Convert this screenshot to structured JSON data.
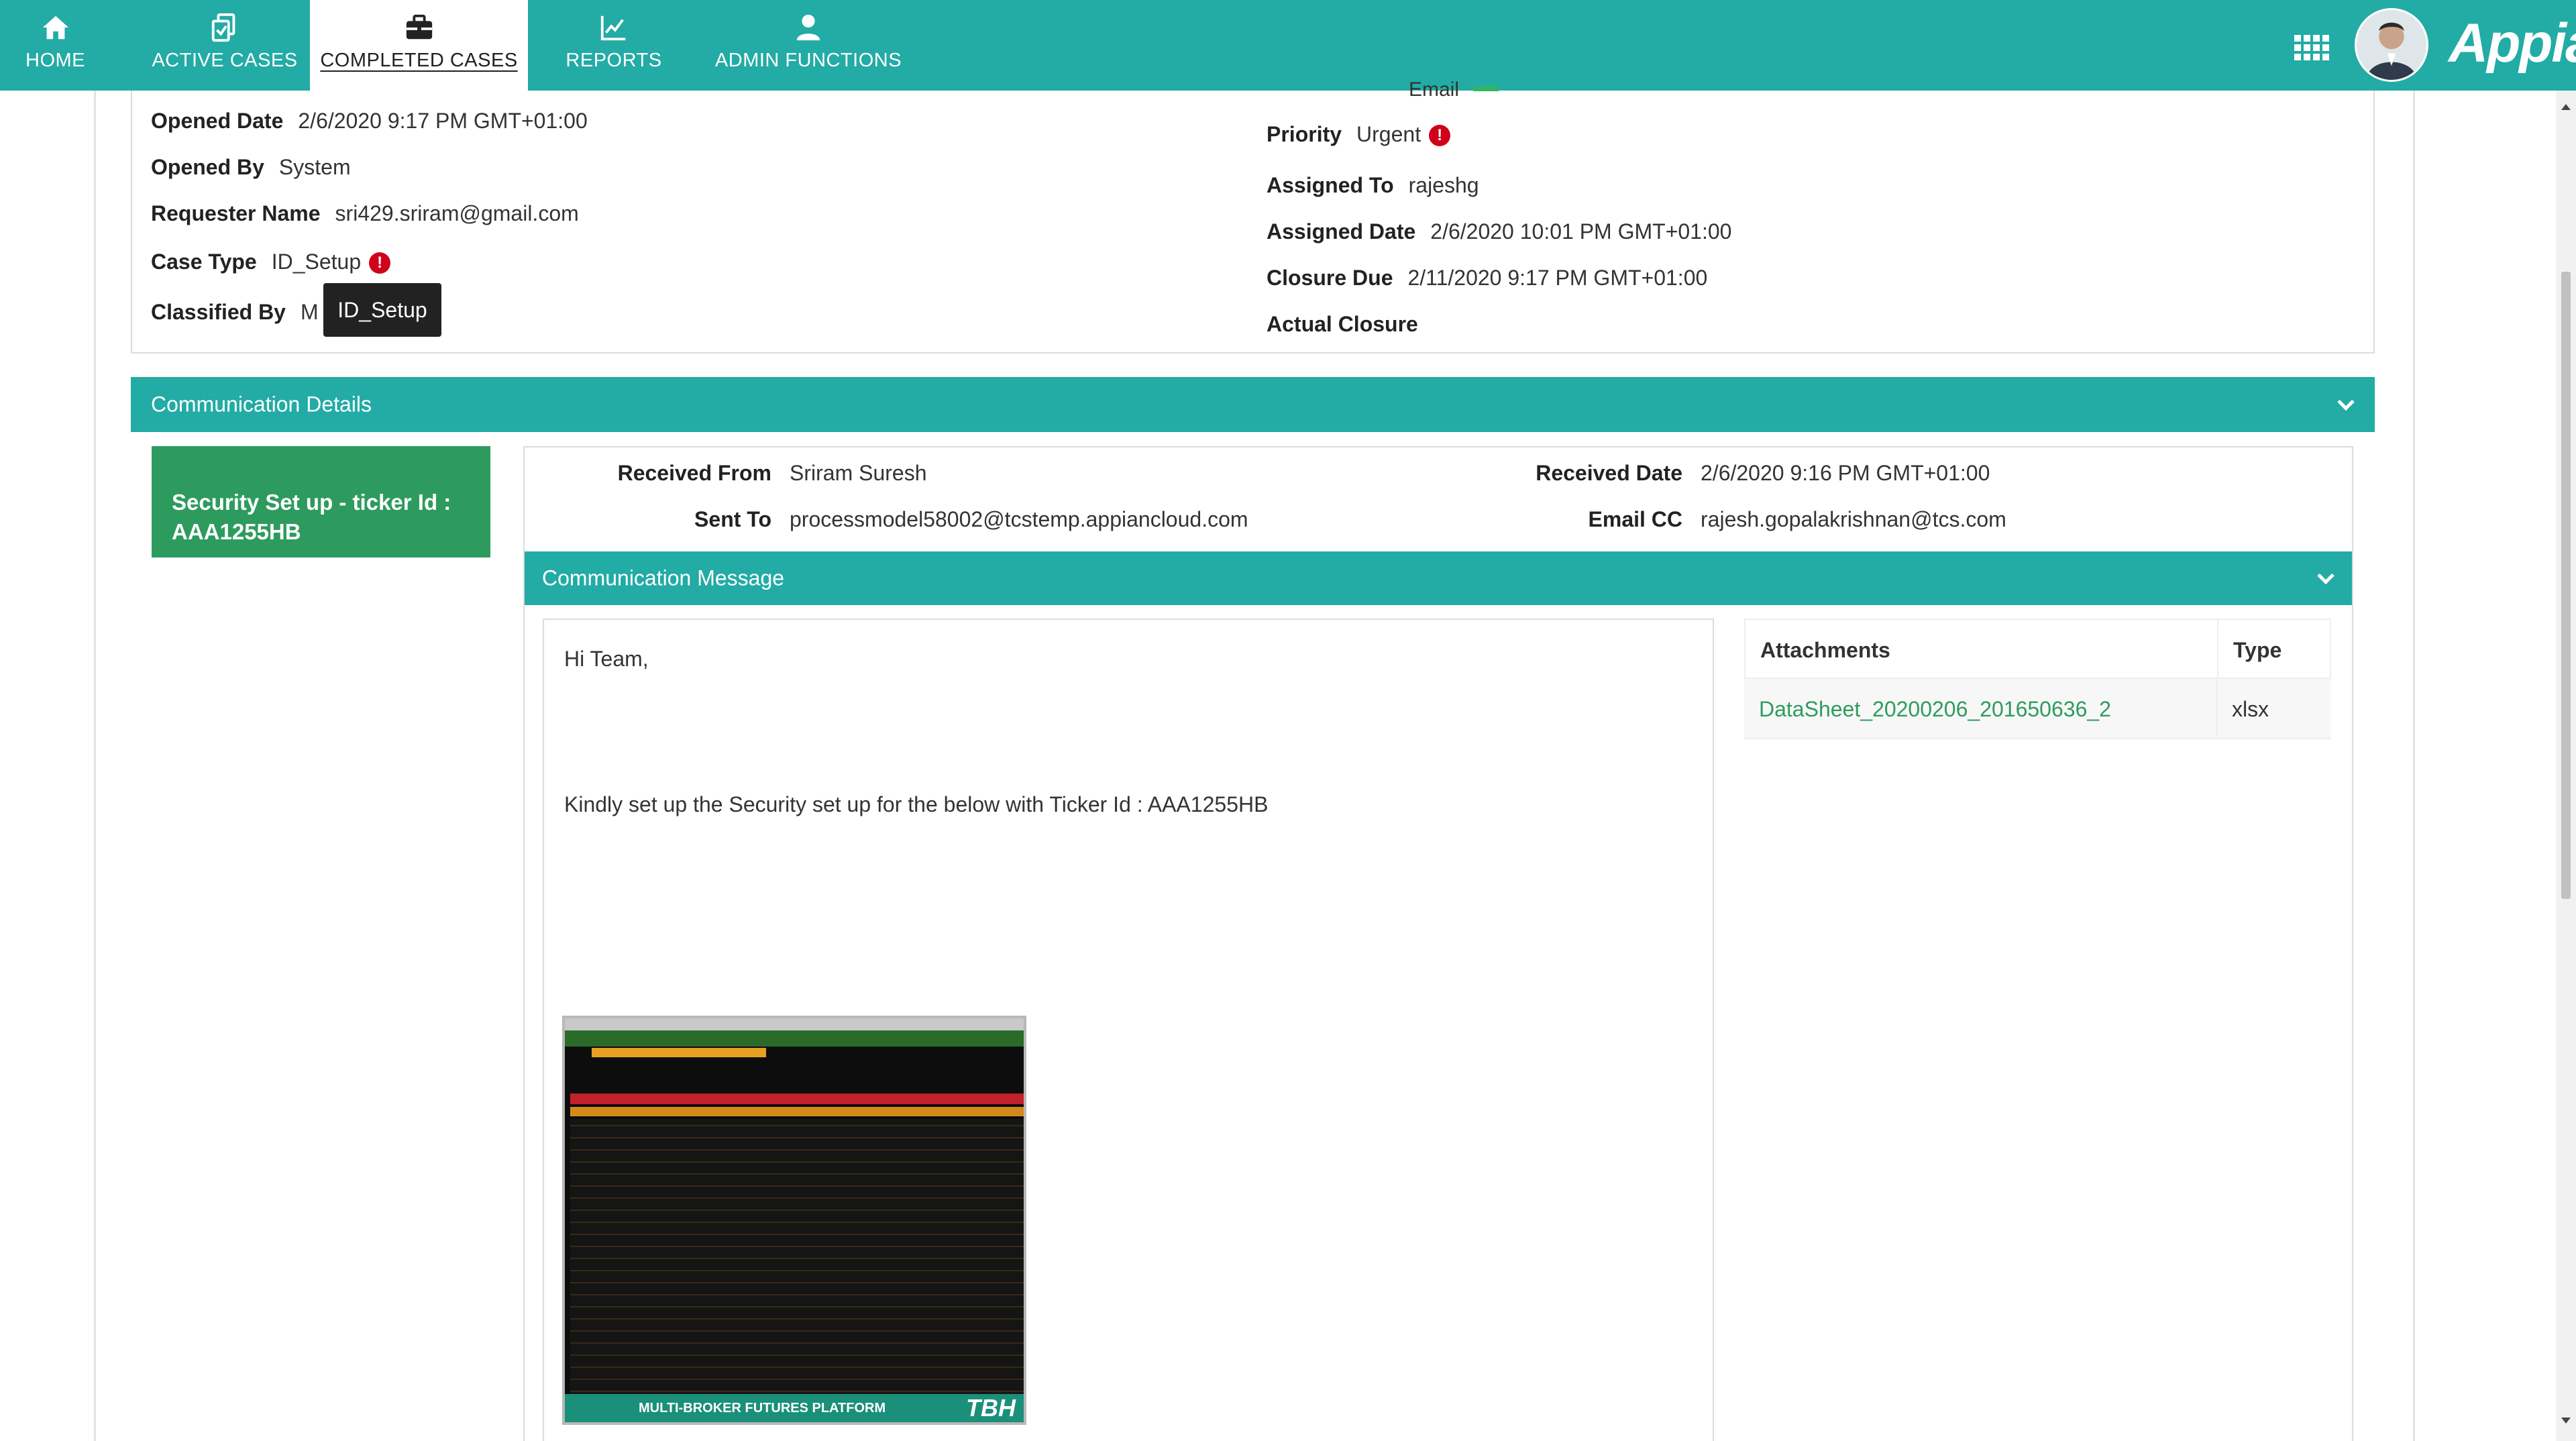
{
  "nav": {
    "items": [
      {
        "label": "HOME",
        "icon": "home-icon"
      },
      {
        "label": "ACTIVE CASES",
        "icon": "active-cases-icon"
      },
      {
        "label": "COMPLETED CASES",
        "icon": "briefcase-icon"
      },
      {
        "label": "REPORTS",
        "icon": "chart-icon"
      },
      {
        "label": "ADMIN FUNCTIONS",
        "icon": "user-icon"
      }
    ],
    "active_index": 2,
    "brand": "Appian",
    "accent_color": "#23aba5"
  },
  "case": {
    "cut_off_label": "Email",
    "opened_date_label": "Opened Date",
    "opened_date": "2/6/2020 9:17 PM GMT+01:00",
    "opened_by_label": "Opened By",
    "opened_by": "System",
    "requester_name_label": "Requester Name",
    "requester_name": "sri429.sriram@gmail.com",
    "case_type_label": "Case Type",
    "case_type": "ID_Setup",
    "classified_by_label": "Classified By",
    "classified_by": "M",
    "tooltip": "ID_Setup",
    "priority_label": "Priority",
    "priority": "Urgent",
    "assigned_to_label": "Assigned To",
    "assigned_to": "rajeshg",
    "assigned_date_label": "Assigned Date",
    "assigned_date": "2/6/2020 10:01 PM GMT+01:00",
    "closure_due_label": "Closure Due",
    "closure_due": "2/11/2020 9:17 PM GMT+01:00",
    "actual_closure_label": "Actual Closure"
  },
  "communication": {
    "section_title": "Communication Details",
    "item_title": "Security Set up - ticker Id : AAA1255HB",
    "received_from_label": "Received From",
    "received_from": "Sriram Suresh",
    "received_date_label": "Received Date",
    "received_date": "2/6/2020 9:16 PM GMT+01:00",
    "sent_to_label": "Sent To",
    "sent_to": "processmodel58002@tcstemp.appiancloud.com",
    "email_cc_label": "Email CC",
    "email_cc": "rajesh.gopalakrishnan@tcs.com",
    "message_section_title": "Communication Message",
    "message_greeting": "Hi Team,",
    "message_body": "Kindly set up the Security set up for the below  with Ticker Id : AAA1255HB",
    "embedded_image_caption": "MULTI-BROKER FUTURES PLATFORM",
    "embedded_image_brand": "TBH",
    "attachments": {
      "col_name": "Attachments",
      "col_type": "Type",
      "rows": [
        {
          "name": "DataSheet_20200206_201650636_2",
          "type": "xlsx"
        }
      ]
    }
  }
}
